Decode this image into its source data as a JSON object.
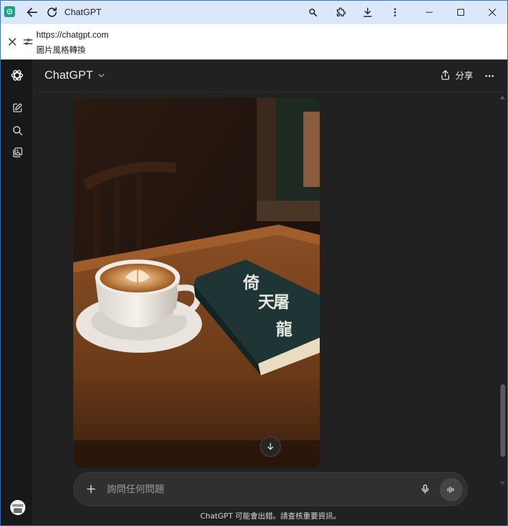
{
  "browser": {
    "tab_title": "ChatGPT",
    "url": "https://chatgpt.com",
    "page_subtitle": "圖片風格轉換"
  },
  "header": {
    "model_label": "ChatGPT",
    "share_label": "分享"
  },
  "image": {
    "book_title_chars": [
      "倚",
      "天",
      "屠",
      "龍"
    ]
  },
  "composer": {
    "placeholder": "詢問任何問題"
  },
  "footer": {
    "disclaimer": "ChatGPT 可能會出錯。請查核重要資訊。"
  },
  "scroll": {
    "position_fraction": 0.8
  },
  "colors": {
    "accent": "#19a37f",
    "background": "#212121",
    "sidebar": "#181818"
  }
}
